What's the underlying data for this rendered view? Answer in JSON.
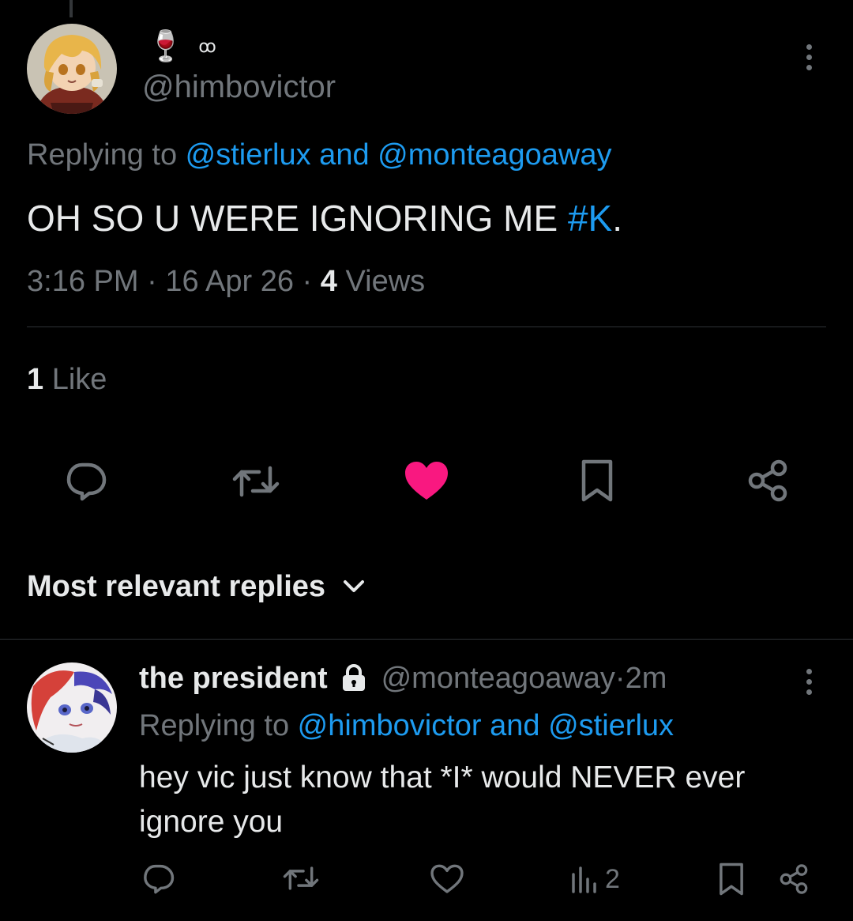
{
  "tweet": {
    "display_name_emoji": "🍷",
    "display_name_suffix": "ꝏ",
    "handle": "@himbovictor",
    "replying_prefix": "Replying to ",
    "replying_mention_1": "@stierlux",
    "replying_and": " and ",
    "replying_mention_2": "@monteagoaway",
    "text_main": "OH SO U WERE IGNORING ME ",
    "text_hashtag": "#K",
    "text_end": ".",
    "time": "3:16 PM",
    "sep": " · ",
    "date": "16 Apr 26",
    "views_count": "4",
    "views_label": " Views",
    "likes_count": "1",
    "likes_label": " Like"
  },
  "actions": {
    "liked": true,
    "like_color": "#f91880"
  },
  "replies_sort": {
    "label": "Most relevant replies"
  },
  "reply": {
    "display_name": "the president",
    "handle": "@monteagoaway",
    "sep": " · ",
    "age": "2m",
    "replying_prefix": "Replying to ",
    "replying_mention_1": "@himbovictor",
    "replying_and": " and ",
    "replying_mention_2": "@stierlux",
    "text_line_1": "hey vic just know that *I* would NEVER ever",
    "text_line_2": "ignore you",
    "views_count": "2"
  },
  "colors": {
    "accent": "#1d9bf0",
    "muted": "#71767b",
    "text": "#e7e9ea",
    "background": "#000000"
  }
}
